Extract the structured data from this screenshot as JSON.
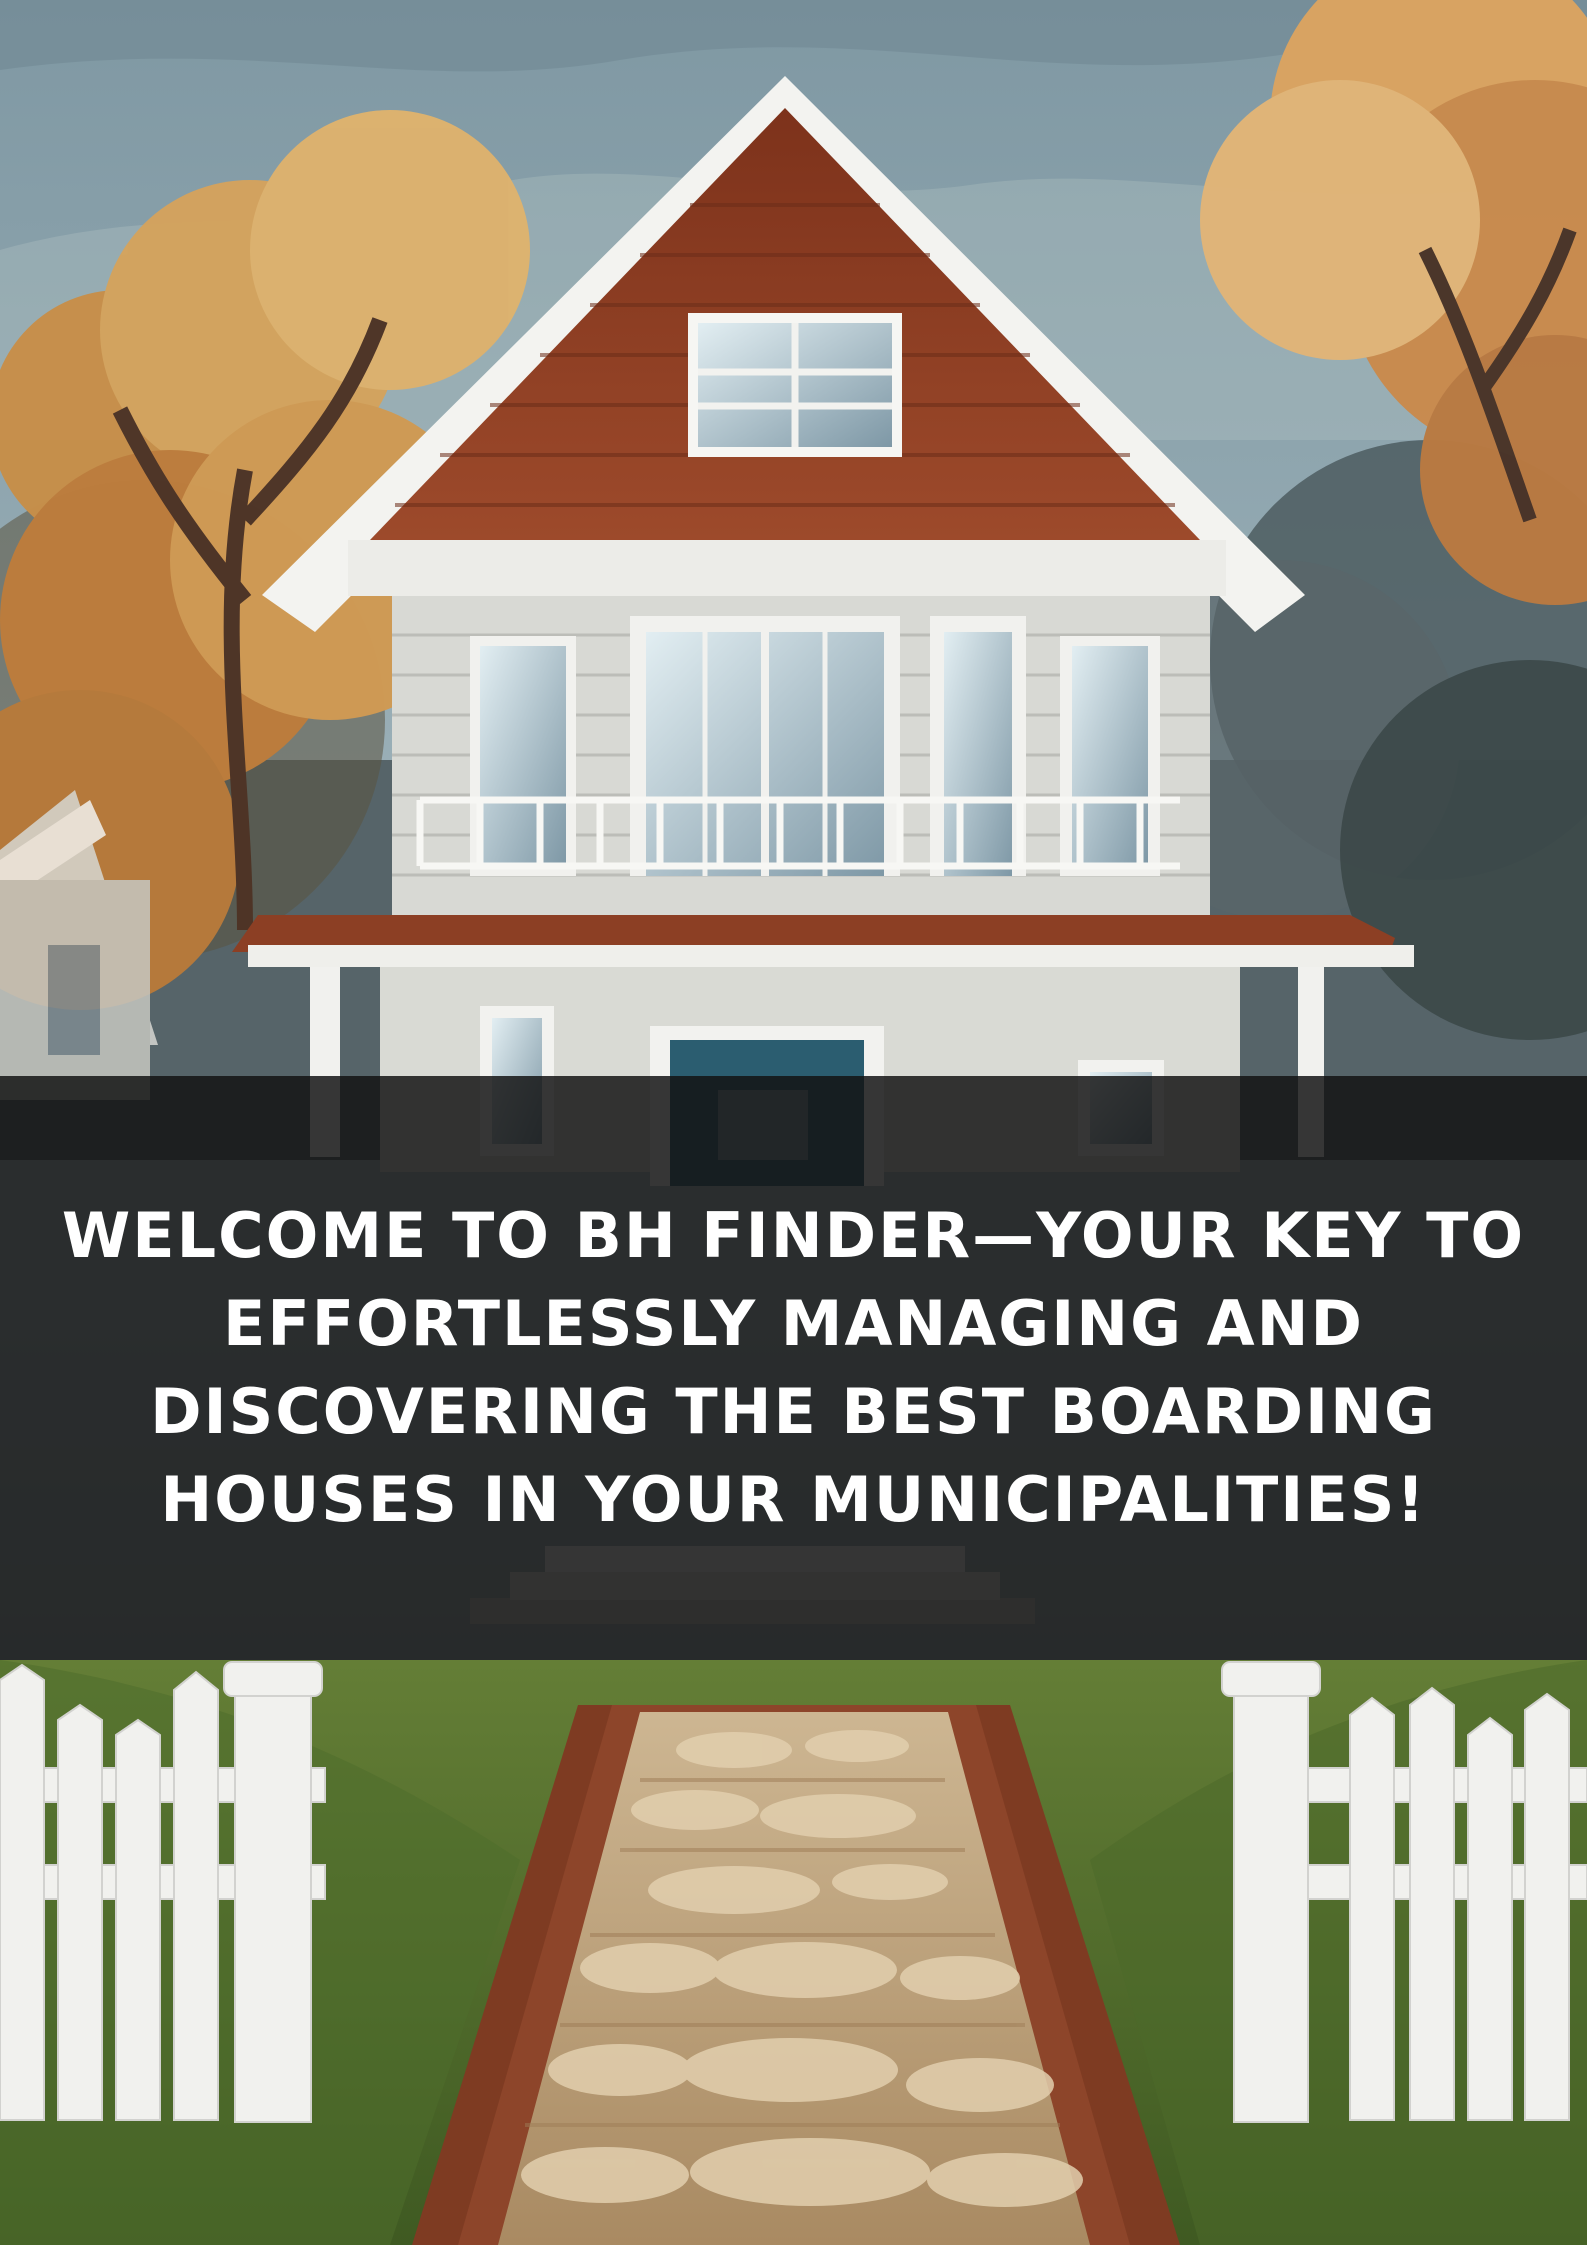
{
  "hero": {
    "headline": "WELCOME TO BH FINDER—YOUR KEY TO EFFORTLESSLY MANAGING AND DISCOVERING THE BEST BOARDING HOUSES IN YOUR MUNICIPALITIES!"
  },
  "illustration": {
    "subject": "house-illustration",
    "colors": {
      "sky": "#93aab2",
      "roof": "#8a3f24",
      "siding": "#d7d7d2",
      "trim": "#f2f2ee",
      "window": "#b8cdd7",
      "door": "#27586a",
      "tree": "#d19b54",
      "lawn": "#5f7f34",
      "brick_path": "#7f3b21",
      "stone_path": "#c4ab86",
      "fence": "#f0f0ec",
      "overlay": "#121212"
    }
  }
}
